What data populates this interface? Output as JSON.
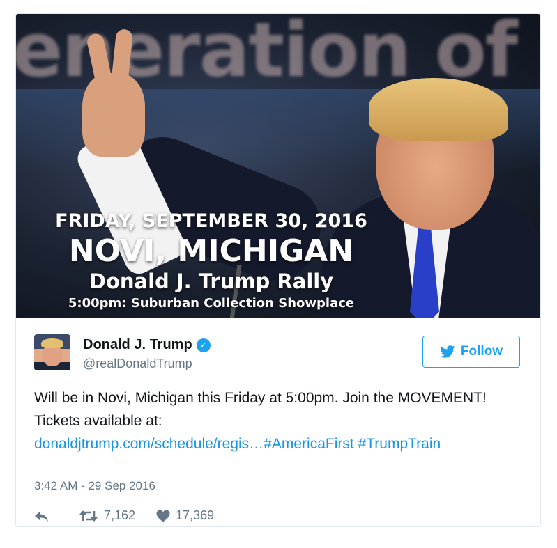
{
  "media": {
    "background_text": "eneration of Cor",
    "line1": "FRIDAY, SEPTEMBER 30, 2016",
    "line2": "NOVI, MICHIGAN",
    "line3": "Donald J. Trump Rally",
    "line4": "5:00pm: Suburban Collection Showplace"
  },
  "tweet": {
    "display_name": "Donald J. Trump",
    "handle": "@realDonaldTrump",
    "verified": true,
    "follow_label": "Follow",
    "text_plain": "Will be in Novi, Michigan this Friday at 5:00pm. Join the MOVEMENT! Tickets available at:",
    "link": "donaldjtrump.com/schedule/regis…",
    "hashtag1": "#AmericaFirst",
    "hashtag2": "#TrumpTrain",
    "timestamp": "3:42 AM - 29 Sep 2016",
    "retweets": "7,162",
    "likes": "17,369"
  },
  "colors": {
    "accent": "#1da1f2",
    "link": "#1b95e0",
    "muted": "#657786"
  },
  "icons": [
    "verified-badge-icon",
    "twitter-bird-icon",
    "reply-icon",
    "retweet-icon",
    "heart-icon"
  ]
}
